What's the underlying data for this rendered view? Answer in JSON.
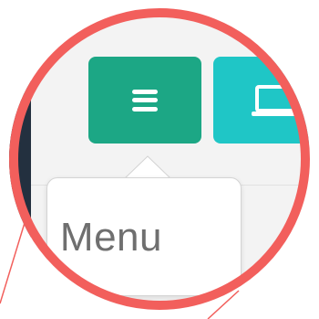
{
  "toolbar": {
    "menu_button": {
      "icon": "hamburger-menu-icon",
      "color": "#1ca785"
    },
    "desktop_button": {
      "icon": "laptop-icon",
      "color": "#1fc6c6"
    }
  },
  "tooltip": {
    "text": "Menu"
  },
  "callout": {
    "ring_color": "#f25f5c"
  }
}
